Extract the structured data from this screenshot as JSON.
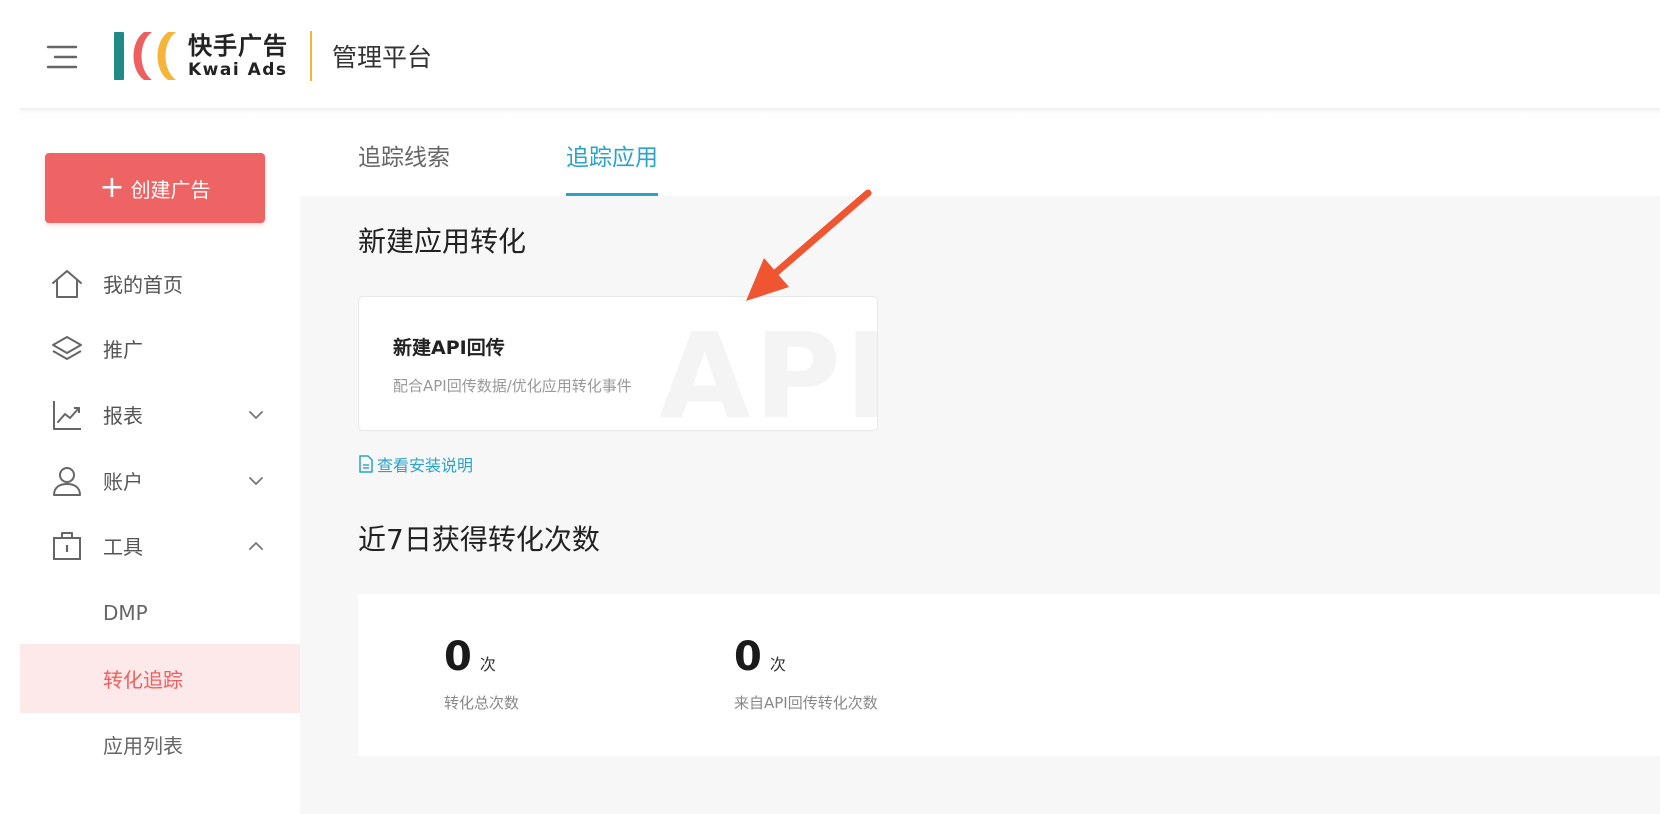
{
  "header": {
    "brand_cn": "快手广告",
    "brand_en": "Kwai Ads",
    "platform": "管理平台",
    "logo_colors": [
      "#1f8a88",
      "#ee5f5f",
      "#f6b43a"
    ]
  },
  "sidebar": {
    "create_button": "创建广告",
    "items": [
      {
        "label": "我的首页",
        "icon": "home-icon"
      },
      {
        "label": "推广",
        "icon": "layers-icon"
      },
      {
        "label": "报表",
        "icon": "chart-icon",
        "expandable": true,
        "expanded": false
      },
      {
        "label": "账户",
        "icon": "user-icon",
        "expandable": true,
        "expanded": false
      },
      {
        "label": "工具",
        "icon": "toolbox-icon",
        "expandable": true,
        "expanded": true
      }
    ],
    "sub_items": [
      {
        "label": "DMP",
        "active": false
      },
      {
        "label": "转化追踪",
        "active": true
      },
      {
        "label": "应用列表",
        "active": false
      }
    ]
  },
  "tabs": [
    {
      "label": "追踪线索",
      "active": false
    },
    {
      "label": "追踪应用",
      "active": true
    }
  ],
  "new_conversion": {
    "title": "新建应用转化",
    "card": {
      "title": "新建API回传",
      "description": "配合API回传数据/优化应用转化事件",
      "watermark": "API"
    },
    "install_link": "查看安装说明"
  },
  "stats": {
    "title": "近7日获得转化次数",
    "items": [
      {
        "value": "0",
        "unit": "次",
        "label": "转化总次数"
      },
      {
        "value": "0",
        "unit": "次",
        "label": "来自API回传转化次数"
      }
    ]
  },
  "colors": {
    "accent_red": "#ee6464",
    "accent_blue": "#2aa3c9",
    "active_bg": "#fde9e9",
    "arrow": "#ee5530"
  }
}
